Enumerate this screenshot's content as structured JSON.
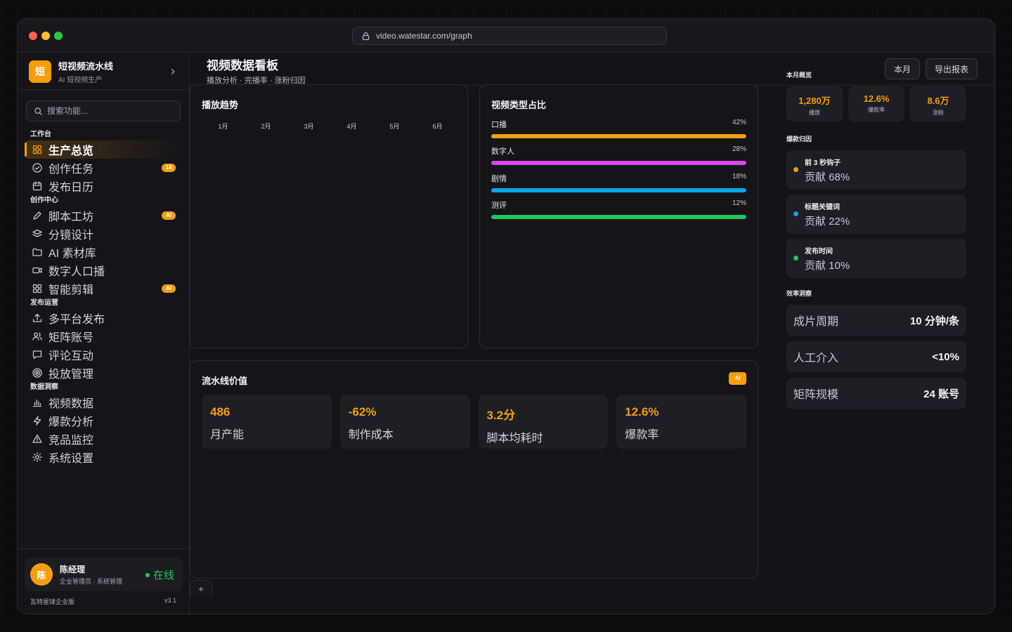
{
  "browser": {
    "url": "video.watestar.com/graph"
  },
  "brand": {
    "logo_char": "短",
    "title": "短视频流水线",
    "subtitle": "AI 短视频生产"
  },
  "search": {
    "placeholder": "搜索功能..."
  },
  "nav": {
    "sections": [
      {
        "title": "工作台",
        "items": [
          {
            "label": "生产总览",
            "icon": "grid-icon",
            "active": true
          },
          {
            "label": "创作任务",
            "icon": "check-circle-icon",
            "badge": "14"
          },
          {
            "label": "发布日历",
            "icon": "calendar-icon"
          }
        ]
      },
      {
        "title": "创作中心",
        "items": [
          {
            "label": "脚本工坊",
            "icon": "pen-icon",
            "badge": "AI"
          },
          {
            "label": "分镜设计",
            "icon": "layers-icon"
          },
          {
            "label": "AI 素材库",
            "icon": "folder-icon"
          },
          {
            "label": "数字人口播",
            "icon": "video-icon"
          },
          {
            "label": "智能剪辑",
            "icon": "grid-icon",
            "badge": "AI"
          }
        ]
      },
      {
        "title": "发布运营",
        "items": [
          {
            "label": "多平台发布",
            "icon": "upload-icon"
          },
          {
            "label": "矩阵账号",
            "icon": "users-icon"
          },
          {
            "label": "评论互动",
            "icon": "message-icon"
          },
          {
            "label": "投放管理",
            "icon": "target-icon"
          }
        ]
      },
      {
        "title": "数据洞察",
        "items": [
          {
            "label": "视频数据",
            "icon": "bar-chart-icon"
          },
          {
            "label": "爆款分析",
            "icon": "lightning-icon"
          },
          {
            "label": "竞品监控",
            "icon": "warning-icon"
          },
          {
            "label": "系统设置",
            "icon": "gear-icon"
          }
        ]
      }
    ]
  },
  "user": {
    "avatar_char": "陈",
    "name": "陈经理",
    "role": "企业管理员 · 系统管理",
    "status": "在线"
  },
  "footer": {
    "edition": "瓦特星球企业版",
    "version": "v3.1"
  },
  "header": {
    "title": "视频数据看板",
    "subtitle": "播放分析 · 完播率 · 涨粉归因",
    "month_button": "本月",
    "export_button": "导出报表"
  },
  "trend": {
    "title": "播放趋势",
    "months": [
      "1月",
      "2月",
      "3月",
      "4月",
      "5月",
      "6月"
    ]
  },
  "share": {
    "title": "视频类型占比",
    "items": [
      {
        "label": "口播",
        "pct": "42%",
        "fill": 1.0,
        "color": "#f59e0b"
      },
      {
        "label": "数字人",
        "pct": "28%",
        "fill": 1.0,
        "color": "#d946ef"
      },
      {
        "label": "剧情",
        "pct": "18%",
        "fill": 1.0,
        "color": "#0ea5e9"
      },
      {
        "label": "测评",
        "pct": "12%",
        "fill": 1.0,
        "color": "#22c55e"
      }
    ]
  },
  "pipeline": {
    "title": "流水线价值",
    "tag": "AI",
    "kpis": [
      {
        "value": "486",
        "label": "月产能"
      },
      {
        "value": "-62%",
        "label": "制作成本"
      },
      {
        "value": "3.2分",
        "label": "脚本均耗时"
      },
      {
        "value": "12.6%",
        "label": "爆款率"
      }
    ]
  },
  "tabs": {
    "add": "+"
  },
  "overview": {
    "title": "本月概览",
    "stats": [
      {
        "value": "1,280万",
        "label": "播放"
      },
      {
        "value": "12.6%",
        "label": "爆款率"
      },
      {
        "value": "8.6万",
        "label": "涨粉"
      }
    ]
  },
  "attribution": {
    "title": "爆款归因",
    "items": [
      {
        "name": "前 3 秒钩子",
        "value": "贡献 68%",
        "color": "#f59e0b"
      },
      {
        "name": "标题关键词",
        "value": "贡献 22%",
        "color": "#0ea5e9"
      },
      {
        "name": "发布时间",
        "value": "贡献 10%",
        "color": "#22c55e"
      }
    ]
  },
  "efficiency": {
    "title": "效率洞察",
    "items": [
      {
        "label": "成片周期",
        "value": "10 分钟/条"
      },
      {
        "label": "人工介入",
        "value": "<10%"
      },
      {
        "label": "矩阵规模",
        "value": "24 账号"
      }
    ]
  }
}
